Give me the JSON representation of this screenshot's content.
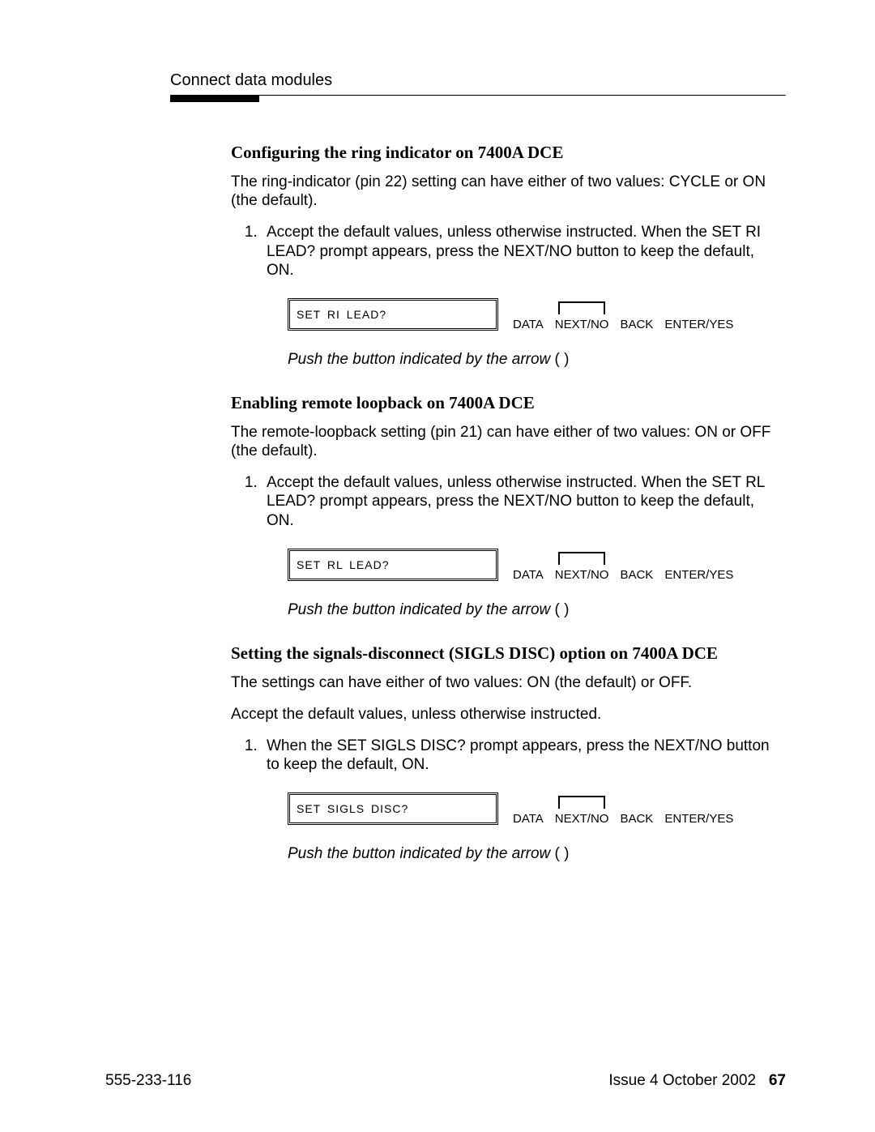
{
  "header": "Connect data modules",
  "sections": [
    {
      "title": "Configuring the ring indicator on 7400A DCE",
      "intro": "The ring-indicator (pin 22) setting can have either of two values: CYCLE or ON (the default).",
      "step": "Accept the default values, unless otherwise instructed. When the SET RI LEAD? prompt appears, press the NEXT/NO button to keep the default, ON.",
      "lcd": "SET  RI LEAD?",
      "buttons": {
        "data": "DATA",
        "nextno": "NEXT/NO",
        "back": "BACK",
        "enteryes": "ENTER/YES"
      },
      "caption_ital": "Push the button indicated by the arrow",
      "caption_suffix": " (    )"
    },
    {
      "title": "Enabling remote loopback on 7400A DCE",
      "intro": "The remote-loopback setting (pin 21) can have either of two values: ON or OFF (the default).",
      "step": "Accept the default values, unless otherwise instructed. When the SET RL LEAD? prompt appears, press the NEXT/NO button to keep the default, ON.",
      "lcd": "SET  RL LEAD?",
      "buttons": {
        "data": "DATA",
        "nextno": "NEXT/NO",
        "back": "BACK",
        "enteryes": "ENTER/YES"
      },
      "caption_ital": "Push the button indicated by the arrow",
      "caption_suffix": " (    )"
    },
    {
      "title": "Setting the signals-disconnect (SIGLS DISC) option on 7400A DCE",
      "intro": "The settings can have either of two values: ON (the default) or OFF.",
      "pre_step": "Accept the default values, unless otherwise instructed.",
      "step": "When the SET SIGLS DISC? prompt appears, press the NEXT/NO button to keep the default, ON.",
      "lcd": "SET  SIGLS DISC?",
      "buttons": {
        "data": "DATA",
        "nextno": "NEXT/NO",
        "back": "BACK",
        "enteryes": "ENTER/YES"
      },
      "caption_ital": "Push the button indicated by the arrow",
      "caption_suffix": " (    )"
    }
  ],
  "footer": {
    "doc": "555-233-116",
    "issue": "Issue 4   October 2002",
    "page": "67"
  }
}
